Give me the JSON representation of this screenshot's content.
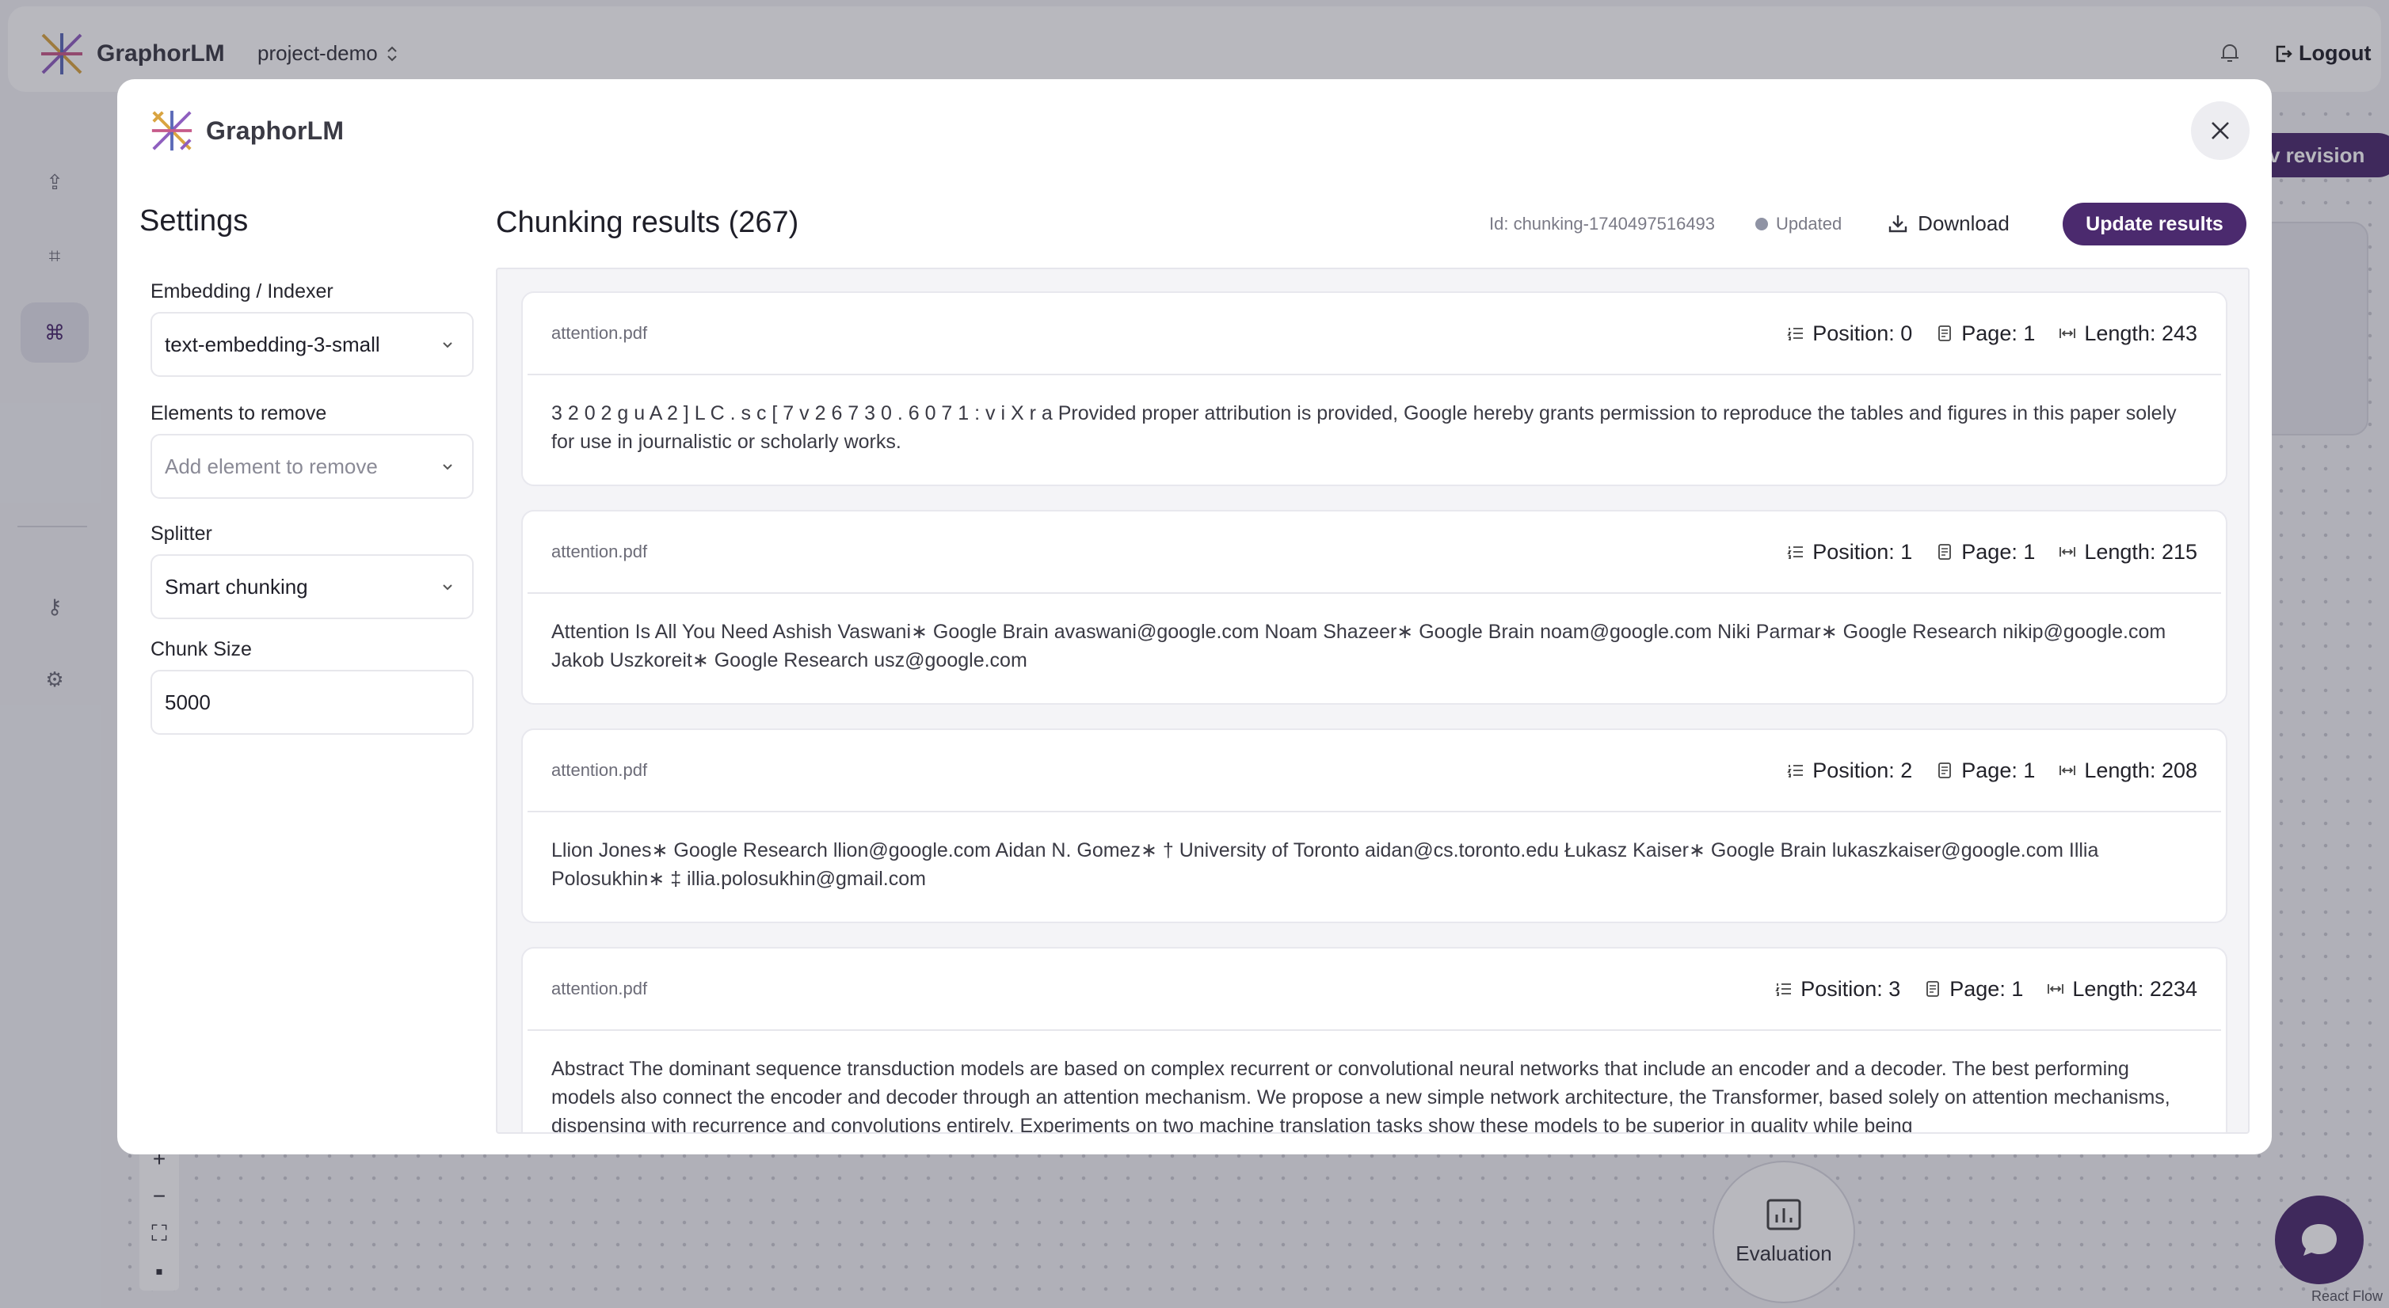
{
  "app": {
    "brand": "GraphorLM",
    "project": "project-demo",
    "logout": "Logout",
    "new_revision": "v revision",
    "evaluation_node": "Evaluation",
    "react_flow": "React Flow"
  },
  "modal": {
    "brand": "GraphorLM",
    "settings": {
      "title": "Settings",
      "embedding_label": "Embedding / Indexer",
      "embedding_value": "text-embedding-3-small",
      "remove_label": "Elements to remove",
      "remove_placeholder": "Add element to remove",
      "splitter_label": "Splitter",
      "splitter_value": "Smart chunking",
      "chunk_size_label": "Chunk Size",
      "chunk_size_value": "5000"
    },
    "results": {
      "title": "Chunking results (267)",
      "id": "Id: chunking-1740497516493",
      "status": "Updated",
      "download": "Download",
      "update": "Update results",
      "chunks": [
        {
          "file": "attention.pdf",
          "position": "Position: 0",
          "page": "Page: 1",
          "length": "Length: 243",
          "text": "3 2 0 2 g u A 2 ] L C . s c [ 7 v 2 6 7 3 0 . 6 0 7 1 : v i X r a Provided proper attribution is provided, Google hereby grants permission to reproduce the tables and figures in this paper solely for use in journalistic or scholarly works."
        },
        {
          "file": "attention.pdf",
          "position": "Position: 1",
          "page": "Page: 1",
          "length": "Length: 215",
          "text": "Attention Is All You Need Ashish Vaswani∗ Google Brain avaswani@google.com Noam Shazeer∗ Google Brain noam@google.com Niki Parmar∗ Google Research nikip@google.com Jakob Uszkoreit∗ Google Research usz@google.com"
        },
        {
          "file": "attention.pdf",
          "position": "Position: 2",
          "page": "Page: 1",
          "length": "Length: 208",
          "text": "Llion Jones∗ Google Research llion@google.com Aidan N. Gomez∗ † University of Toronto aidan@cs.toronto.edu Łukasz Kaiser∗ Google Brain lukaszkaiser@google.com Illia Polosukhin∗ ‡ illia.polosukhin@gmail.com"
        },
        {
          "file": "attention.pdf",
          "position": "Position: 3",
          "page": "Page: 1",
          "length": "Length: 2234",
          "text": "Abstract The dominant sequence transduction models are based on complex recurrent or convolutional neural networks that include an encoder and a decoder. The best performing models also connect the encoder and decoder through an attention mechanism. We propose a new simple network architecture, the Transformer, based solely on attention mechanisms, dispensing with recurrence and convolutions entirely. Experiments on two machine translation tasks show these models to be superior in quality while being"
        }
      ]
    }
  },
  "colors": {
    "accent": "#4b2a6e",
    "panel_bg": "#f4f4f7",
    "border": "#e6e6ec"
  },
  "icons": {
    "close": "close-icon",
    "chevron": "chevron-down-icon",
    "download": "download-icon",
    "position": "list-ordered-icon",
    "page": "page-icon",
    "length": "length-icon"
  }
}
